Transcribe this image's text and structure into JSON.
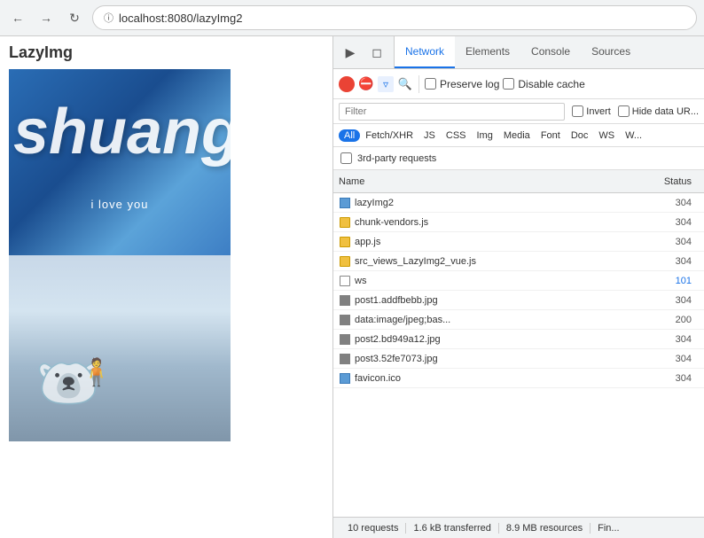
{
  "browser": {
    "url": "localhost:8080/lazyImg2",
    "back_btn": "←",
    "forward_btn": "→",
    "reload_btn": "↻"
  },
  "page": {
    "title": "LazyImg",
    "images": [
      "blue-text",
      "winter-scene"
    ]
  },
  "devtools": {
    "tool_icons": [
      "cursor",
      "device"
    ],
    "tabs": [
      {
        "label": "Network",
        "active": true
      },
      {
        "label": "Elements",
        "active": false
      },
      {
        "label": "Console",
        "active": false
      },
      {
        "label": "Sources",
        "active": false
      }
    ],
    "toolbar": {
      "preserve_log_label": "Preserve log",
      "disable_cache_label": "Disable cache"
    },
    "filter": {
      "placeholder": "Filter",
      "invert_label": "Invert",
      "hide_data_label": "Hide data UR..."
    },
    "resource_types": [
      {
        "label": "All",
        "active": true
      },
      {
        "label": "Fetch/XHR",
        "active": false
      },
      {
        "label": "JS",
        "active": false
      },
      {
        "label": "CSS",
        "active": false
      },
      {
        "label": "Img",
        "active": false
      },
      {
        "label": "Media",
        "active": false
      },
      {
        "label": "Font",
        "active": false
      },
      {
        "label": "Doc",
        "active": false
      },
      {
        "label": "WS",
        "active": false
      },
      {
        "label": "W...",
        "active": false
      }
    ],
    "third_party_label": "3rd-party requests",
    "table": {
      "col_name": "Name",
      "col_status": "Status",
      "rows": [
        {
          "icon": "doc",
          "name": "lazyImg2",
          "status": "304"
        },
        {
          "icon": "js",
          "name": "chunk-vendors.js",
          "status": "304"
        },
        {
          "icon": "js",
          "name": "app.js",
          "status": "304"
        },
        {
          "icon": "js",
          "name": "src_views_LazyImg2_vue.js",
          "status": "304"
        },
        {
          "icon": "ws",
          "name": "ws",
          "status": "101"
        },
        {
          "icon": "img",
          "name": "post1.addfbebb.jpg",
          "status": "304"
        },
        {
          "icon": "img",
          "name": "data:image/jpeg;bas...",
          "status": "200"
        },
        {
          "icon": "img",
          "name": "post2.bd949a12.jpg",
          "status": "304"
        },
        {
          "icon": "img",
          "name": "post3.52fe7073.jpg",
          "status": "304"
        },
        {
          "icon": "doc",
          "name": "favicon.ico",
          "status": "304"
        }
      ]
    },
    "status_bar": {
      "requests": "10 requests",
      "transferred": "1.6 kB transferred",
      "resources": "8.9 MB resources",
      "finish": "Fin..."
    }
  }
}
